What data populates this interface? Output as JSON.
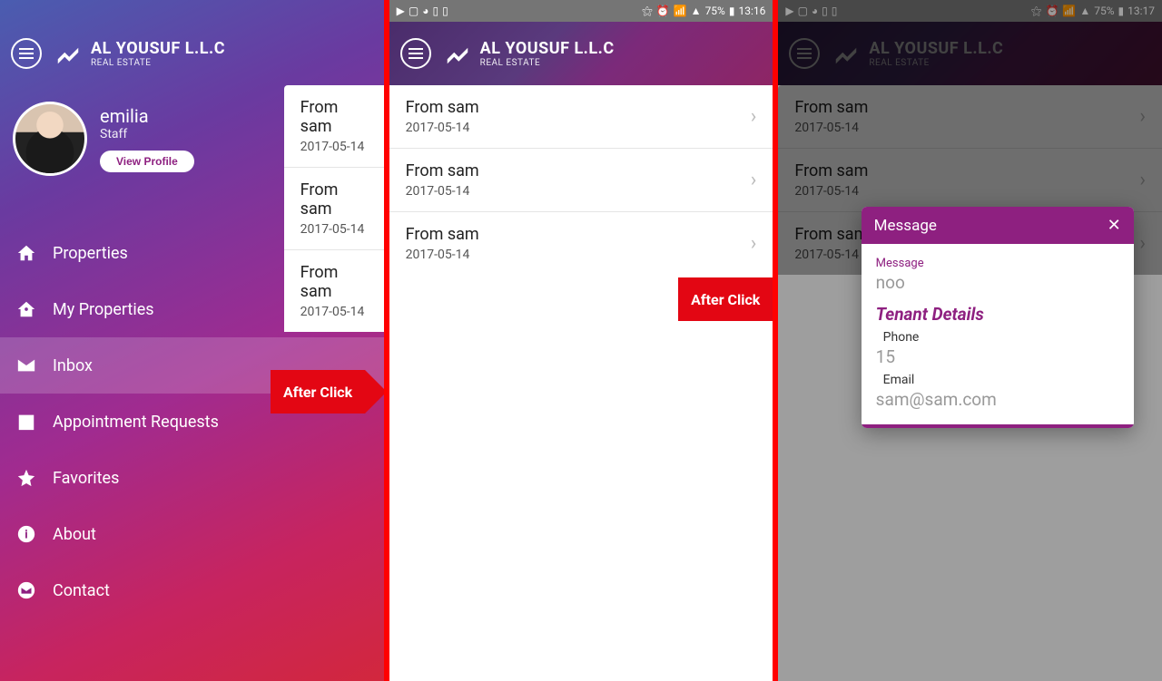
{
  "statusbar": {
    "battery": "75%",
    "time1": "13:16",
    "time2": "13:16",
    "time3": "13:17"
  },
  "brand": {
    "title": "AL YOUSUF L.L.C",
    "subtitle": "REAL ESTATE"
  },
  "profile": {
    "name": "emilia",
    "role": "Staff",
    "viewProfile": "View Profile"
  },
  "menu": {
    "items": [
      {
        "label": "Properties"
      },
      {
        "label": "My Properties"
      },
      {
        "label": "Inbox"
      },
      {
        "label": "Appointment Requests"
      },
      {
        "label": "Favorites"
      },
      {
        "label": "About"
      },
      {
        "label": "Contact"
      }
    ]
  },
  "inbox": {
    "items": [
      {
        "from": "From sam",
        "date": "2017-05-14"
      },
      {
        "from": "From sam",
        "date": "2017-05-14"
      },
      {
        "from": "From sam",
        "date": "2017-05-14"
      }
    ]
  },
  "afterClick": "After Click",
  "modal": {
    "header": "Message",
    "messageLabel": "Message",
    "messageValue": "noo",
    "tenantHeading": "Tenant Details",
    "phoneLabel": "Phone",
    "phoneValue": "15",
    "emailLabel": "Email",
    "emailValue": "sam@sam.com"
  }
}
